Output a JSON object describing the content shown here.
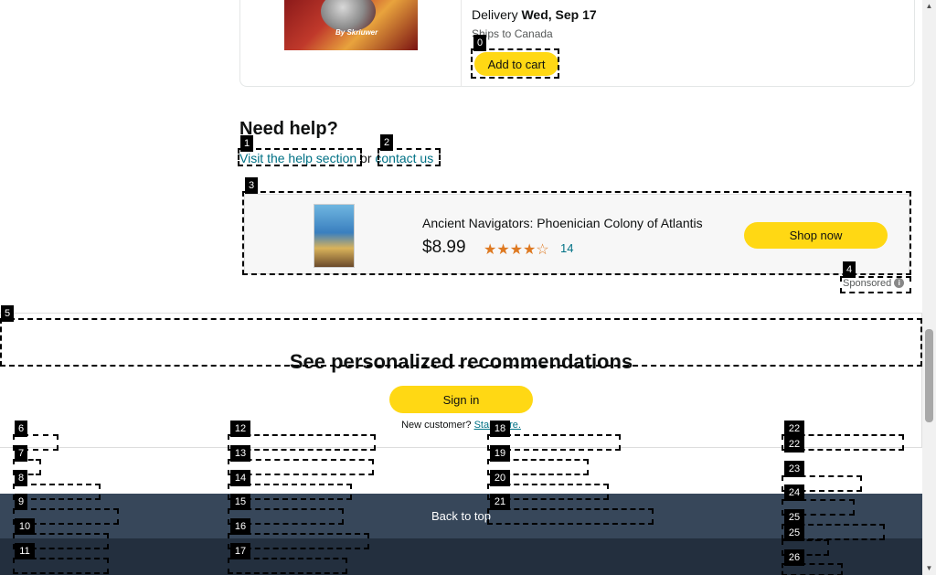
{
  "product": {
    "cover_caption": "By Skriuwer",
    "delivery_label": "Delivery",
    "delivery_date": "Wed, Sep 17",
    "ships_to": "Ships to Canada",
    "add_to_cart": "Add to cart"
  },
  "help": {
    "heading": "Need help?",
    "help_link": "Visit the help section",
    "or_text": "or",
    "contact_link": "contact us"
  },
  "sponsored_ad": {
    "title": "Ancient Navigators: Phoenician Colony of Atlantis",
    "price": "$8.99",
    "rating_stars": "★★★★☆",
    "review_count": "14",
    "cta": "Shop now",
    "sponsored_label": "Sponsored",
    "info_icon": "i"
  },
  "recommendations": {
    "heading": "See personalized recommendations",
    "sign_in": "Sign in",
    "new_customer": "New customer?",
    "start_here": "Start here."
  },
  "footer": {
    "back_to_top": "Back to top"
  },
  "annotations": {
    "labels": [
      "0",
      "1",
      "2",
      "3",
      "4",
      "5",
      "6",
      "7",
      "8",
      "9",
      "10",
      "11",
      "12",
      "13",
      "14",
      "15",
      "16",
      "17",
      "18",
      "19",
      "20",
      "21",
      "22",
      "22",
      "23",
      "24",
      "25",
      "25",
      "26"
    ]
  },
  "colors": {
    "accent_button": "#ffd814",
    "link": "#007185",
    "back_to_top_bg": "#37475a",
    "footer_bg": "#232f3e",
    "star": "#de7921"
  }
}
